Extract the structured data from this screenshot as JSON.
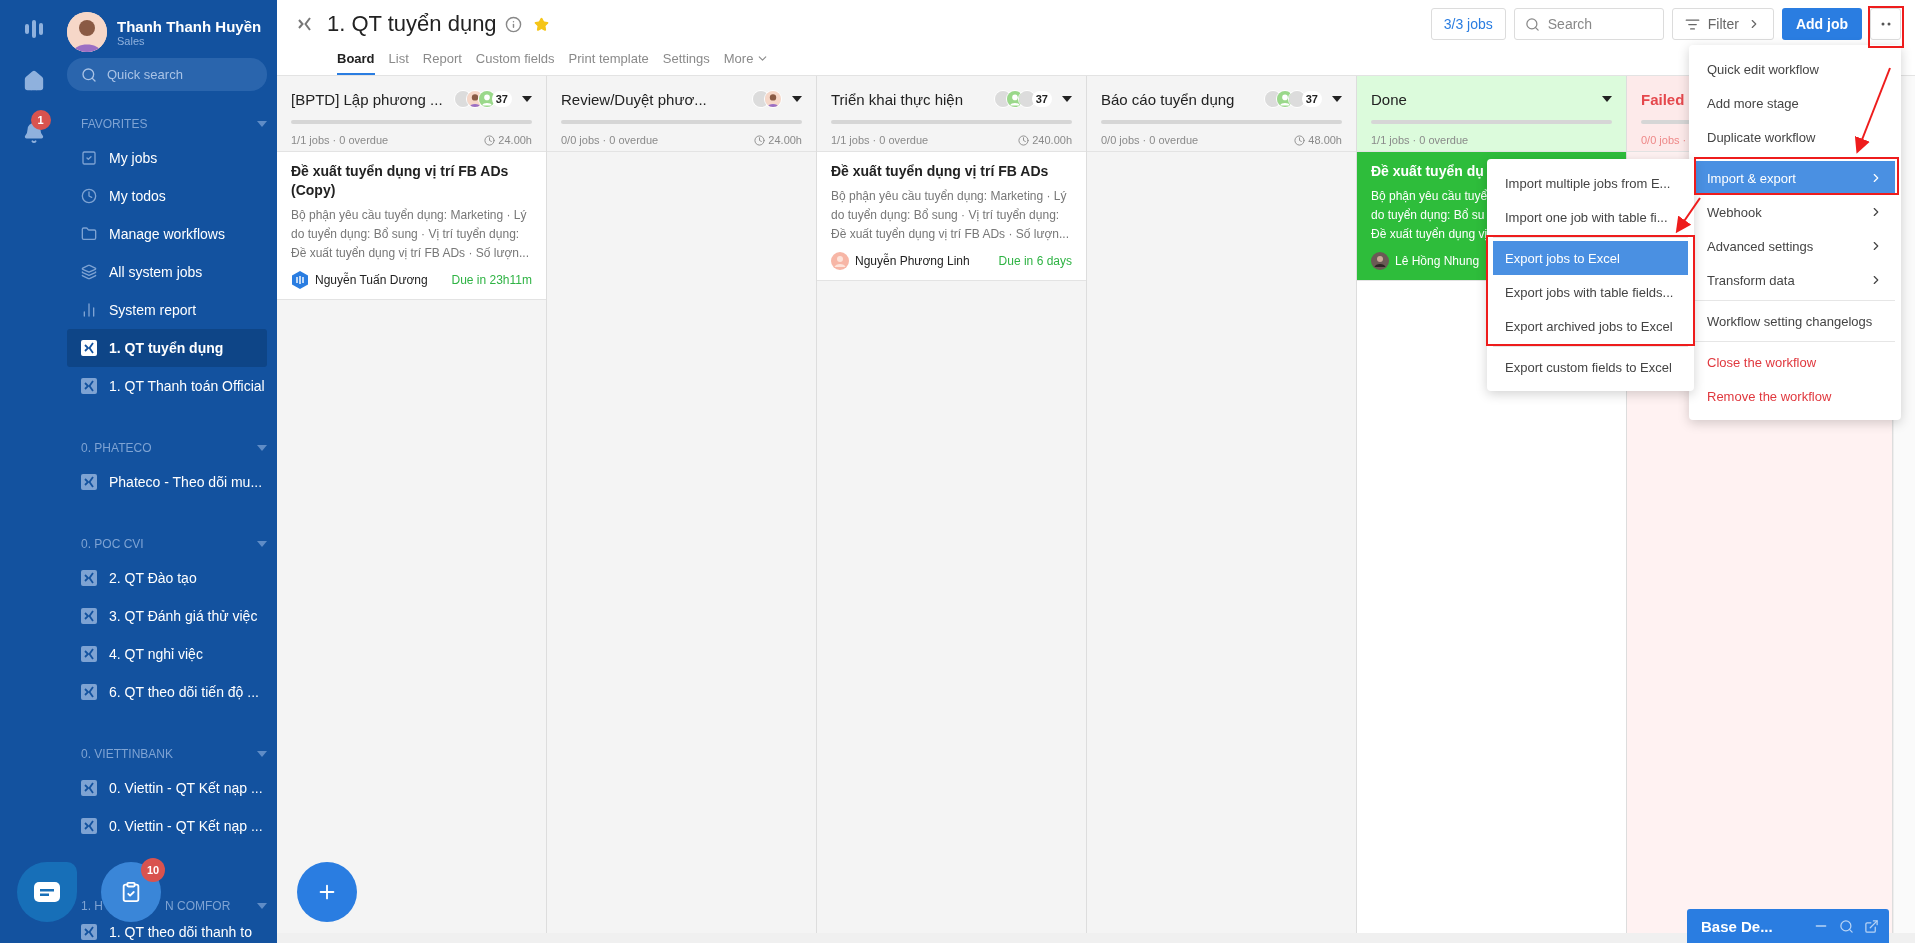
{
  "rail": {
    "notification_badge": "1"
  },
  "user": {
    "name": "Thanh Thanh Huyền",
    "role": "Sales"
  },
  "sidebar": {
    "search": {
      "placeholder": "Quick search"
    },
    "sections": [
      {
        "label": "FAVORITES",
        "items": [
          {
            "label": "My jobs",
            "kind": "check",
            "selected": false
          },
          {
            "label": "My todos",
            "kind": "clock",
            "selected": false
          },
          {
            "label": "Manage workflows",
            "kind": "folder",
            "selected": false
          },
          {
            "label": "All system jobs",
            "kind": "layers",
            "selected": false
          },
          {
            "label": "System report",
            "kind": "chart",
            "selected": false
          },
          {
            "label": "1. QT tuyển dụng",
            "kind": "workflow",
            "selected": true
          },
          {
            "label": "1. QT Thanh toán Official",
            "kind": "workflow",
            "selected": false
          }
        ]
      },
      {
        "label": "0. PHATECO",
        "items": [
          {
            "label": "Phateco - Theo dõi mu...",
            "kind": "workflow",
            "selected": false
          }
        ]
      },
      {
        "label": "0. POC CVI",
        "items": [
          {
            "label": "2. QT Đào tạo",
            "kind": "workflow",
            "selected": false
          },
          {
            "label": "3. QT Đánh giá thử việc",
            "kind": "workflow",
            "selected": false
          },
          {
            "label": "4. QT nghỉ việc",
            "kind": "workflow",
            "selected": false
          },
          {
            "label": "6. QT theo dõi tiến độ ...",
            "kind": "workflow",
            "selected": false
          }
        ]
      },
      {
        "label": "0. VIETTINBANK",
        "items": [
          {
            "label": "0. Viettin - QT Kết nạp ...",
            "kind": "workflow",
            "selected": false
          },
          {
            "label": "0. Viettin - QT Kết nạp ...",
            "kind": "workflow",
            "selected": false
          }
        ]
      },
      {
        "label": "1. H",
        "label_tail": "N COMFOR",
        "items": [
          {
            "label": "1. QT theo dõi thanh to",
            "kind": "workflow",
            "selected": false
          }
        ]
      }
    ]
  },
  "floating": {
    "tasks_badge": "10"
  },
  "workflow": {
    "title": "1. QT tuyển dụng",
    "starred": true,
    "tabs": [
      {
        "label": "Board",
        "selected": true
      },
      {
        "label": "List",
        "selected": false
      },
      {
        "label": "Report",
        "selected": false
      },
      {
        "label": "Custom fields",
        "selected": false
      },
      {
        "label": "Print template",
        "selected": false
      },
      {
        "label": "Settings",
        "selected": false
      },
      {
        "label": "More",
        "selected": false
      }
    ]
  },
  "toolbar": {
    "jobs": "3/3 jobs",
    "search": {
      "placeholder": "Search"
    },
    "filter": "Filter",
    "add_job": "Add job"
  },
  "columns": [
    {
      "title": "[BPTD] Lập phương ...",
      "kind": "normal",
      "avatars": [
        {
          "kind": "blank"
        },
        {
          "kind": "person"
        },
        {
          "kind": "green"
        }
      ],
      "count": "37",
      "stats": "1/1 jobs · 0 overdue",
      "hours": "24.00h",
      "cards": [
        {
          "kind": "normal",
          "title": "Đề xuất tuyển dụng vị trí FB ADs (Copy)",
          "description": "Bộ phận yêu cầu tuyển dụng: Marketing · Lý do tuyển dụng: Bổ sung · Vị trí tuyển dụng: Đề xuất tuyển dụng vị trí FB ADs · Số lượn...",
          "assignee": "Nguyễn Tuấn Dương",
          "avatar": {
            "kind": "badge"
          },
          "due": "Due in 23h11m"
        }
      ]
    },
    {
      "title": "Review/Duyệt phươ...",
      "kind": "normal",
      "avatars": [
        {
          "kind": "blank"
        },
        {
          "kind": "person"
        }
      ],
      "stats": "0/0 jobs · 0 overdue",
      "hours": "24.00h"
    },
    {
      "title": "Triển khai thực hiện",
      "kind": "normal",
      "avatars": [
        {
          "kind": "blank"
        },
        {
          "kind": "green"
        },
        {
          "kind": "blank"
        }
      ],
      "count": "37",
      "stats": "1/1 jobs · 0 overdue",
      "hours": "240.00h",
      "cards": [
        {
          "kind": "normal",
          "title": "Đề xuất tuyển dụng vị trí FB ADs",
          "description": "Bộ phận yêu cầu tuyển dụng: Marketing · Lý do tuyển dụng: Bổ sung · Vị trí tuyển dụng: Đề xuất tuyển dụng vị trí FB ADs · Số lượn...",
          "assignee": "Nguyễn Phương Linh",
          "avatar": {
            "kind": "pink"
          },
          "due": "Due in 6 days"
        }
      ]
    },
    {
      "title": "Báo cáo tuyển dụng",
      "kind": "normal",
      "avatars": [
        {
          "kind": "blank"
        },
        {
          "kind": "green"
        },
        {
          "kind": "blank"
        }
      ],
      "count": "37",
      "stats": "0/0 jobs · 0 overdue",
      "hours": "48.00h"
    },
    {
      "title": "Done",
      "kind": "done",
      "stats": "1/1 jobs · 0 overdue",
      "cards": [
        {
          "kind": "done",
          "title": "Đề xuất tuyển dụ",
          "lines": [
            "Bộ phận yêu cầu tuyể",
            "do tuyển dụng: Bổ su",
            "Đề xuất tuyển dụng vị"
          ],
          "assignee": "Lê Hồng Nhung",
          "avatar": {
            "kind": "photo"
          }
        }
      ]
    },
    {
      "title": "Failed",
      "kind": "failed",
      "stats": "0/0 jobs ·"
    }
  ],
  "menu": {
    "groups": [
      [
        {
          "label": "Quick edit workflow",
          "kind": "normal",
          "submenu": false,
          "selected": false
        },
        {
          "label": "Add more stage",
          "kind": "normal",
          "submenu": false,
          "selected": false
        },
        {
          "label": "Duplicate workflow",
          "kind": "normal",
          "submenu": false,
          "selected": false
        }
      ],
      [
        {
          "label": "Import & export",
          "kind": "normal",
          "submenu": true,
          "selected": true
        },
        {
          "label": "Webhook",
          "kind": "normal",
          "submenu": true,
          "selected": false
        },
        {
          "label": "Advanced settings",
          "kind": "normal",
          "submenu": true,
          "selected": false
        },
        {
          "label": "Transform data",
          "kind": "normal",
          "submenu": true,
          "selected": false
        }
      ],
      [
        {
          "label": "Workflow setting changelogs",
          "kind": "normal",
          "submenu": false,
          "selected": false
        }
      ],
      [
        {
          "label": "Close the workflow",
          "kind": "danger",
          "submenu": false,
          "selected": false
        },
        {
          "label": "Remove the workflow",
          "kind": "danger",
          "submenu": false,
          "selected": false
        }
      ]
    ]
  },
  "submenu": {
    "groups": [
      [
        {
          "label": "Import multiple jobs from E...",
          "selected": false
        },
        {
          "label": "Import one job with table fi...",
          "selected": false
        }
      ],
      [
        {
          "label": "Export jobs to Excel",
          "selected": true
        },
        {
          "label": "Export jobs with table fields...",
          "selected": false
        },
        {
          "label": "Export archived jobs to Excel",
          "selected": false
        }
      ],
      [
        {
          "label": "Export custom fields to Excel",
          "selected": false
        }
      ]
    ]
  },
  "chat_widget": {
    "title": "Base De..."
  }
}
